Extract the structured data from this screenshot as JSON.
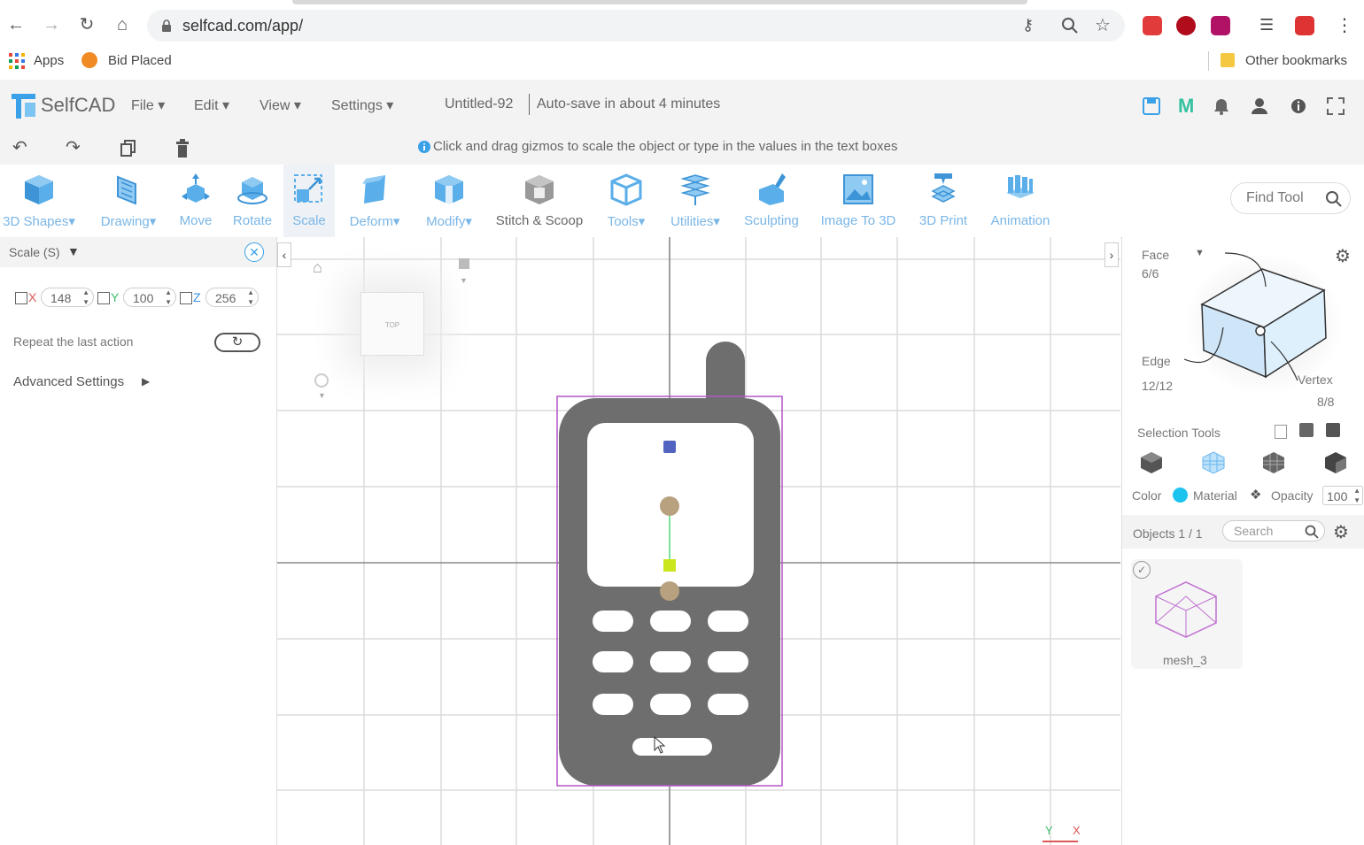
{
  "browser": {
    "url": "selfcad.com/app/",
    "bookmarks": [
      {
        "label": "Apps",
        "icon": "apps-grid-icon"
      },
      {
        "label": "Bid Placed",
        "icon": "bid-icon"
      }
    ],
    "other_bookmarks": "Other bookmarks"
  },
  "app": {
    "logo_text": "SelfCAD",
    "menus": [
      "File",
      "Edit",
      "View",
      "Settings"
    ],
    "file_name": "Untitled-92",
    "autosave": "Auto-save in about 4 minutes",
    "hint": "Click and drag gizmos to scale the object or type in the values in the text boxes",
    "find_tool": "Find Tool",
    "accent": "#3aa0e8"
  },
  "toolbar": [
    {
      "label": "3D Shapes",
      "dropdown": true
    },
    {
      "label": "Drawing",
      "dropdown": true
    },
    {
      "label": "Move",
      "dropdown": false
    },
    {
      "label": "Rotate",
      "dropdown": false
    },
    {
      "label": "Scale",
      "dropdown": false,
      "active": true
    },
    {
      "label": "Deform",
      "dropdown": true
    },
    {
      "label": "Modify",
      "dropdown": true
    },
    {
      "label": "Stitch & Scoop",
      "dropdown": false
    },
    {
      "label": "Tools",
      "dropdown": true
    },
    {
      "label": "Utilities",
      "dropdown": true
    },
    {
      "label": "Sculpting",
      "dropdown": false
    },
    {
      "label": "Image To 3D",
      "dropdown": false
    },
    {
      "label": "3D Print",
      "dropdown": false
    },
    {
      "label": "Animation",
      "dropdown": false
    }
  ],
  "scale_panel": {
    "title": "Scale (S)",
    "x_label": "X",
    "x_value": "148",
    "y_label": "Y",
    "y_value": "100",
    "z_label": "Z",
    "z_value": "256",
    "repeat": "Repeat the last action",
    "advanced": "Advanced Settings"
  },
  "viewport": {
    "cube_face": "TOP",
    "axis_y": "Y",
    "axis_x": "X"
  },
  "right_panel": {
    "face_label": "Face",
    "face_count": "6/6",
    "edge_label": "Edge",
    "edge_count": "12/12",
    "vertex_label": "Vertex",
    "vertex_count": "8/8",
    "selection_tools": "Selection Tools",
    "color": "Color",
    "material": "Material",
    "opacity": "Opacity",
    "opacity_value": "100",
    "objects": "Objects 1 / 1",
    "search_placeholder": "Search",
    "object_name": "mesh_3"
  }
}
